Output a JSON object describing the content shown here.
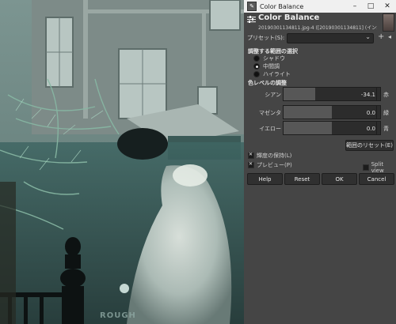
{
  "window": {
    "title": "Color Balance",
    "app_icon": "gimp-icon"
  },
  "dialog": {
    "heading": "Color Balance",
    "subtitle": "20190301134811.jpg-4 ([20190301134811] (インポートさ...",
    "preset": {
      "label": "プリセット(S):",
      "value": ""
    },
    "range_section": {
      "title": "調整する範囲の選択",
      "options": [
        "シャドウ",
        "中間調",
        "ハイライト"
      ],
      "selected": 1
    },
    "levels_section": {
      "title": "色レベルの調整",
      "sliders": [
        {
          "left": "シアン",
          "right": "赤",
          "value": "-34.1",
          "numeric": -34.1
        },
        {
          "left": "マゼンタ",
          "right": "緑",
          "value": "0.0",
          "numeric": 0.0
        },
        {
          "left": "イエロー",
          "right": "青",
          "value": "0.0",
          "numeric": 0.0
        }
      ]
    },
    "reset_range_label": "範囲のリセット(E)",
    "preserve_luminosity": {
      "label": "輝度の保持(L)",
      "checked": true
    },
    "preview": {
      "label": "プレビュー(P)",
      "checked": true
    },
    "split_view": {
      "label": "Split view",
      "checked": false
    },
    "buttons": {
      "help": "Help",
      "reset": "Reset",
      "ok": "OK",
      "cancel": "Cancel"
    }
  },
  "photo": {
    "watermark_text": "ROUGH"
  }
}
